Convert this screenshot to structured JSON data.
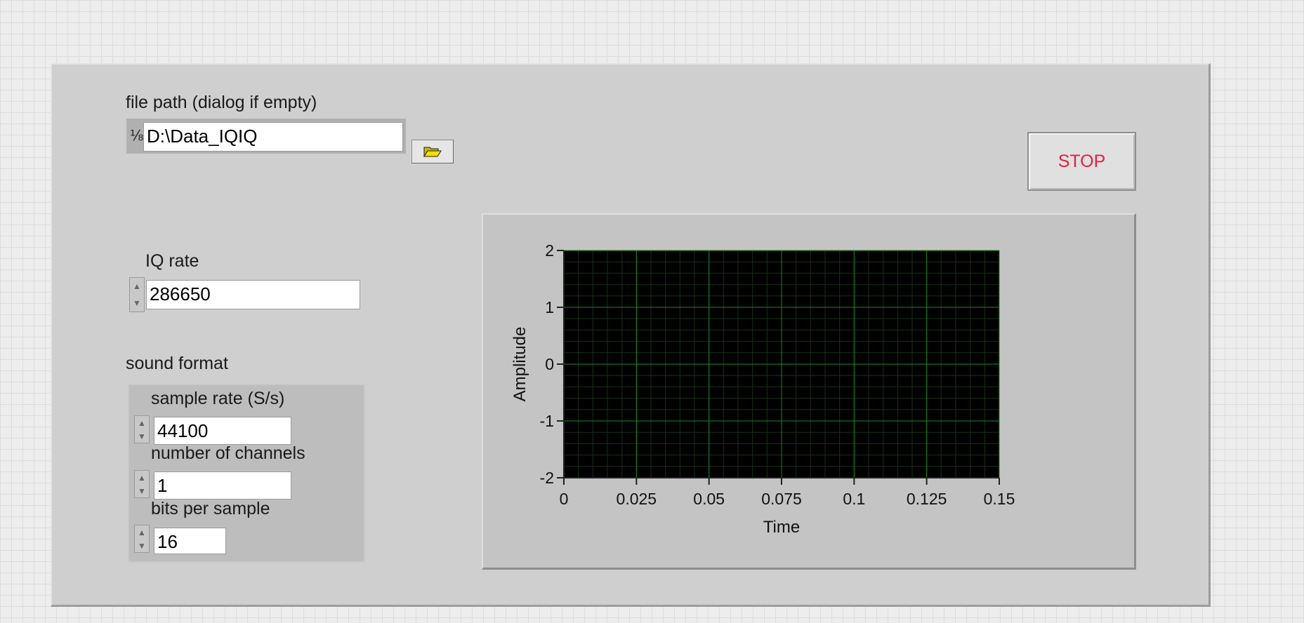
{
  "file_path": {
    "label": "file path (dialog if empty)",
    "value": "D:\\Data_IQIQ",
    "browse_icon": "folder-open-icon"
  },
  "iq_rate": {
    "label": "IQ rate",
    "value": "286650"
  },
  "sound_format": {
    "label": "sound format",
    "sample_rate_label": "sample rate (S/s)",
    "sample_rate_value": "44100",
    "channels_label": "number of channels",
    "channels_value": "1",
    "bits_label": "bits per sample",
    "bits_value": "16"
  },
  "stop_button": {
    "label": "STOP",
    "color": "#e2213e"
  },
  "chart_data": {
    "type": "line",
    "title": "",
    "xlabel": "Time",
    "ylabel": "Amplitude",
    "xlim": [
      0,
      0.15
    ],
    "ylim": [
      -2,
      2
    ],
    "x_ticks": [
      "0",
      "0.025",
      "0.05",
      "0.075",
      "0.1",
      "0.125",
      "0.15"
    ],
    "y_ticks": [
      "2",
      "1",
      "0",
      "-1",
      "-2"
    ],
    "grid": true,
    "plot_background": "#000000",
    "grid_color": "#1e8a1e",
    "series": []
  }
}
